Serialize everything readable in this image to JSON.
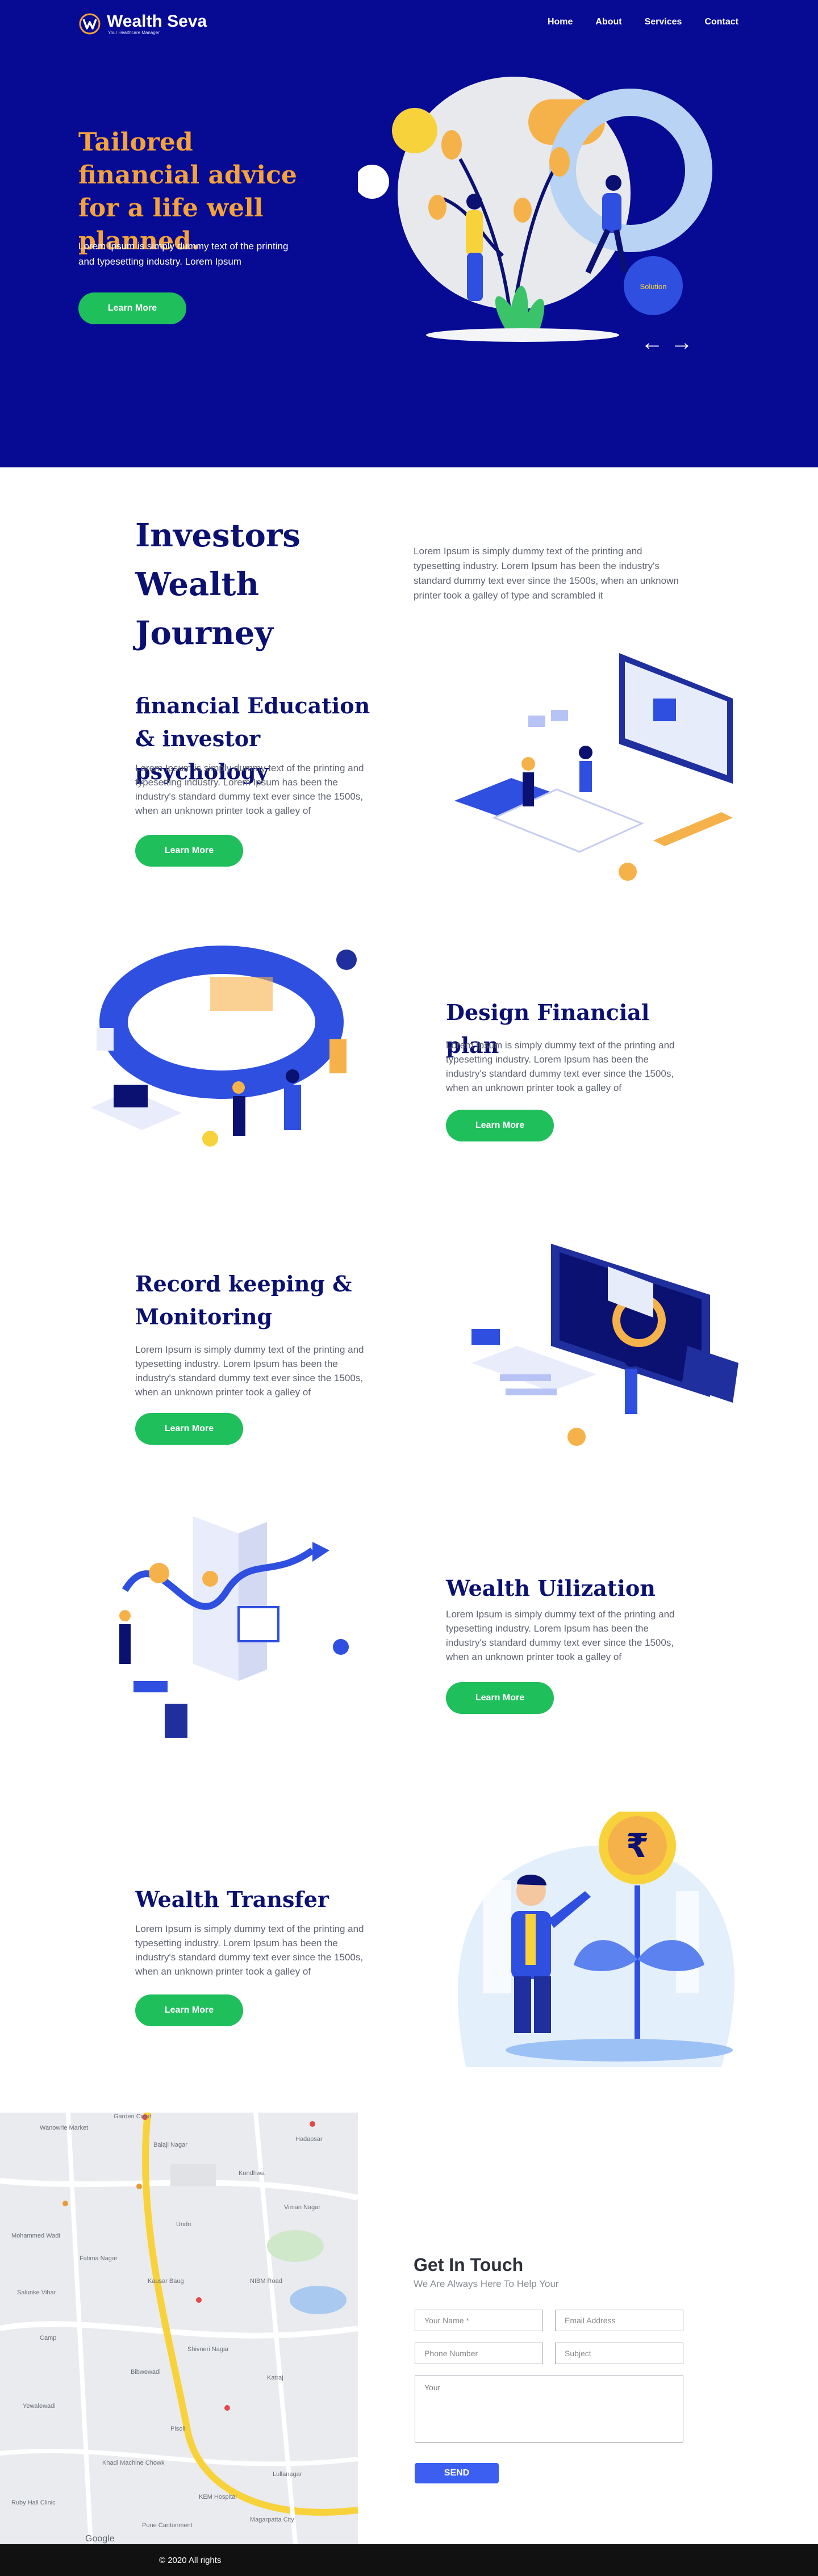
{
  "brand": {
    "name": "Wealth Seva",
    "tagline": "Your Healthcare Manager",
    "accent": "#f4a23a",
    "primary": "#070a93",
    "button": "#1fbf5b"
  },
  "nav": {
    "items": [
      "Home",
      "About",
      "Services",
      "Contact"
    ]
  },
  "hero": {
    "title": "Tailored financial advice for a life well planned.",
    "text": "Lorem Ipsum is simply dummy text of the printing and typesetting industry. Lorem Ipsum",
    "button": "Learn More",
    "art_label": "Solution",
    "prev_icon": "arrow-left-icon",
    "next_icon": "arrow-right-icon"
  },
  "journey": {
    "title": "Investors Wealth Journey",
    "text": "Lorem Ipsum is simply dummy text of the printing and typesetting industry. Lorem Ipsum has been the industry's standard dummy text ever since the 1500s, when an unknown printer took a galley of type and scrambled it"
  },
  "features": [
    {
      "title": "financial Education & investor psychology",
      "text": "Lorem Ipsum is simply dummy text of the printing and typesetting industry. Lorem Ipsum has been the industry's standard dummy text ever since the 1500s, when an unknown printer took a galley of",
      "button": "Learn More"
    },
    {
      "title": "Design Financial plan",
      "text": "Lorem Ipsum is simply dummy text of the printing and typesetting industry. Lorem Ipsum has been the industry's standard dummy text ever since the 1500s, when an unknown printer took a galley of",
      "button": "Learn More"
    },
    {
      "title": "Record keeping & Monitoring",
      "text": "Lorem Ipsum is simply dummy text of the printing and typesetting industry. Lorem Ipsum has been the industry's standard dummy text ever since the 1500s, when an unknown printer took a galley of",
      "button": "Learn More"
    },
    {
      "title": "Wealth Uilization",
      "text": "Lorem Ipsum is simply dummy text of the printing and typesetting industry. Lorem Ipsum has been the industry's standard dummy text ever since the 1500s, when an unknown printer took a galley of",
      "button": "Learn More"
    },
    {
      "title": "Wealth Transfer",
      "text": "Lorem Ipsum is simply dummy text of the printing and typesetting industry. Lorem Ipsum has been the industry's standard dummy text ever since the 1500s, when an unknown printer took a galley of",
      "button": "Learn More"
    }
  ],
  "contact": {
    "title": "Get In Touch",
    "subtitle": "We Are Always Here To Help Your",
    "name_placeholder": "Your Name *",
    "email_placeholder": "Email Address",
    "phone_placeholder": "Phone Number",
    "subject_placeholder": "Subject",
    "message_placeholder": "Your",
    "send": "SEND"
  },
  "map": {
    "labels": [
      "Garden Court",
      "Wanowrie Market",
      "Balaji Nagar",
      "Hadapsar",
      "Kondhwa",
      "Viman Nagar",
      "Mohammed Wadi",
      "Undri",
      "Fatima Nagar",
      "NIBM Road",
      "Salunke Vihar",
      "Kausar Baug",
      "Camp",
      "Shivneri Nagar",
      "Bibwewadi",
      "Katraj",
      "Yewalewadi",
      "Pisoli",
      "Khadi Machine Chowk",
      "Lullanagar",
      "KEM Hospital",
      "Ruby Hall Clinic",
      "Magarpatta City",
      "Pune Cantonment",
      "Google"
    ]
  },
  "footer": {
    "text": "© 2020 All rights"
  }
}
